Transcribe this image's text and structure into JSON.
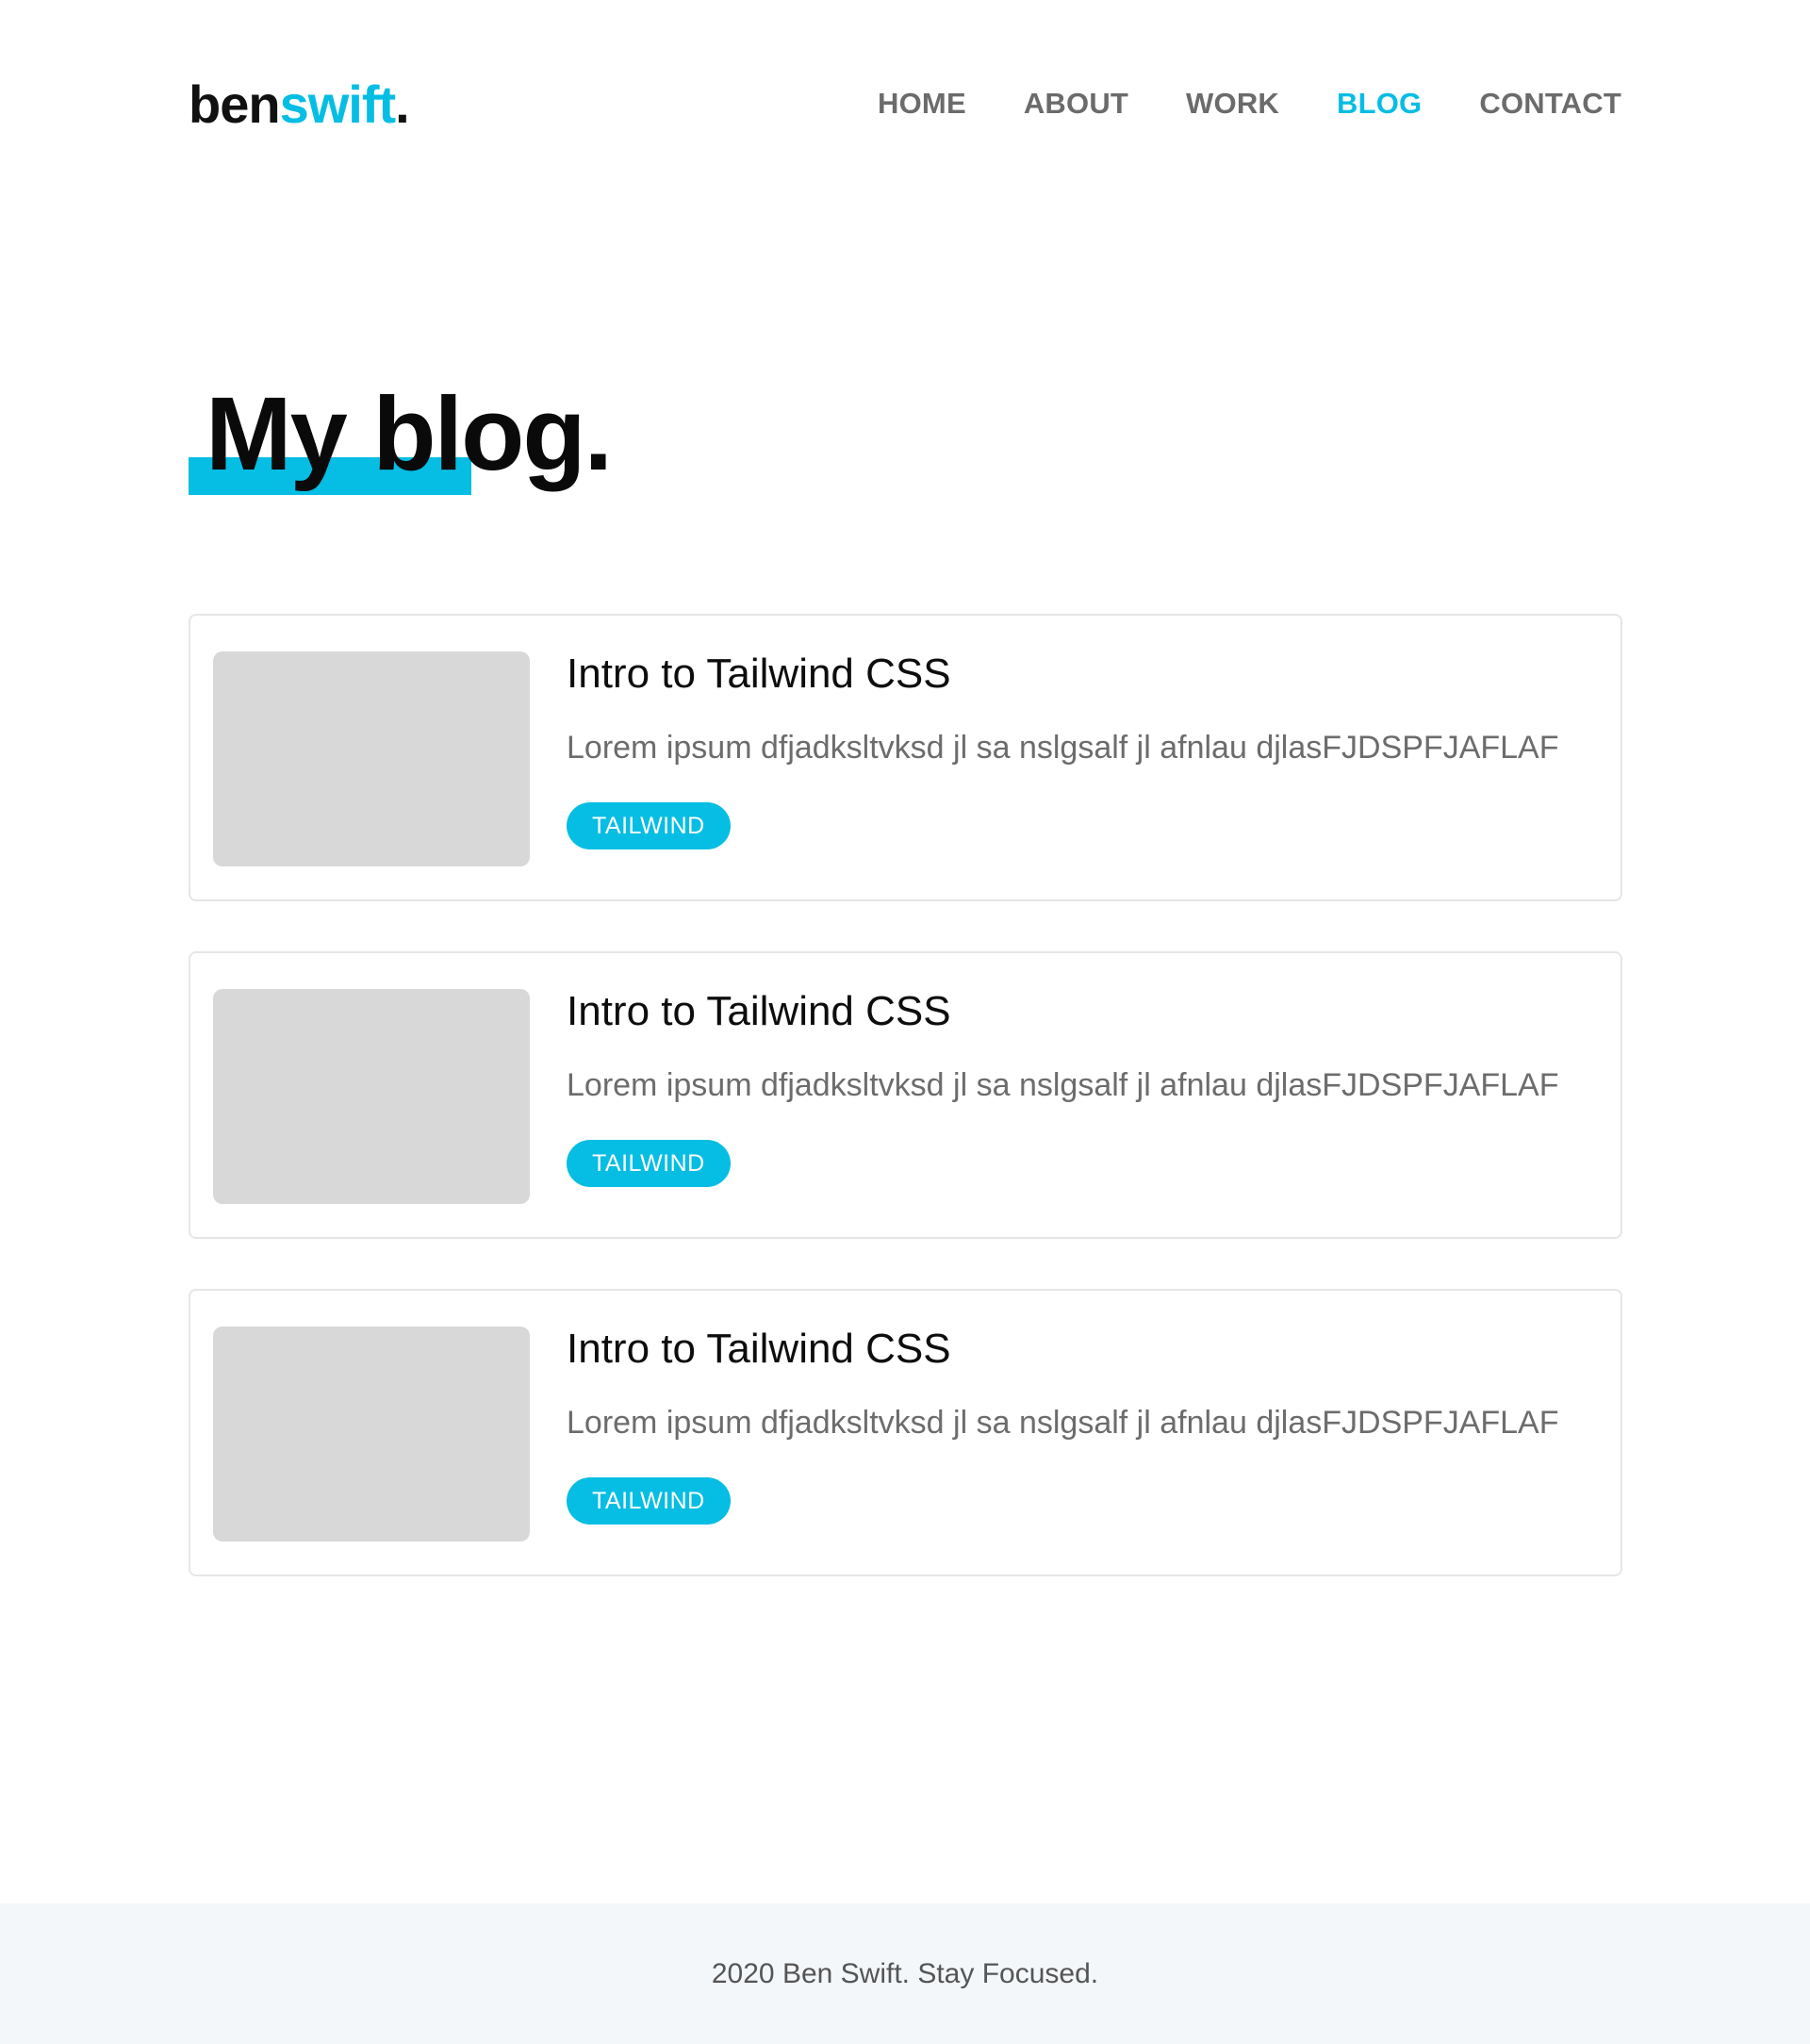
{
  "header": {
    "logo": {
      "part1": "ben",
      "part2": "swift",
      "part3": "."
    },
    "nav": [
      {
        "label": "HOME",
        "active": false
      },
      {
        "label": "ABOUT",
        "active": false
      },
      {
        "label": "WORK",
        "active": false
      },
      {
        "label": "BLOG",
        "active": true
      },
      {
        "label": "CONTACT",
        "active": false
      }
    ]
  },
  "main": {
    "title": "My blog.",
    "posts": [
      {
        "title": "Intro to Tailwind CSS",
        "excerpt": "Lorem ipsum dfjadksltvksd jl sa nslgsalf  jl afnlau djlasFJDSPFJAFLAF",
        "tag": "TAILWIND"
      },
      {
        "title": "Intro to Tailwind CSS",
        "excerpt": "Lorem ipsum dfjadksltvksd jl sa nslgsalf  jl afnlau djlasFJDSPFJAFLAF",
        "tag": "TAILWIND"
      },
      {
        "title": "Intro to Tailwind CSS",
        "excerpt": "Lorem ipsum dfjadksltvksd jl sa nslgsalf  jl afnlau djlasFJDSPFJAFLAF",
        "tag": "TAILWIND"
      }
    ]
  },
  "footer": {
    "text": "2020 Ben Swift. Stay Focused."
  },
  "colors": {
    "accent": "#06bde3",
    "text_dark": "#0d0d0d",
    "text_muted": "#6c6c6c",
    "nav_inactive": "#6b6b6b",
    "thumb_placeholder": "#d8d8d8",
    "footer_bg": "#f4f7fa"
  }
}
